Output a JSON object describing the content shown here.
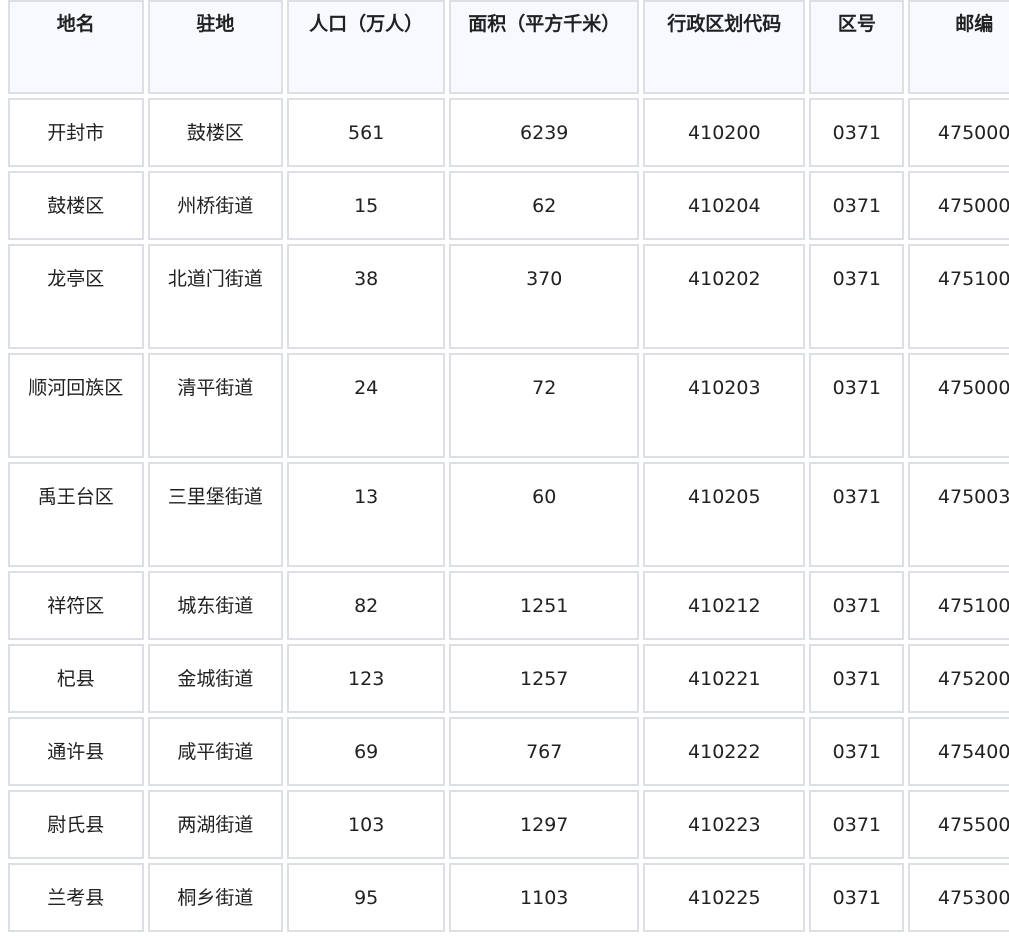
{
  "table": {
    "headers": [
      "地名",
      "驻地",
      "人口（万人）",
      "面积（平方千米）",
      "行政区划代码",
      "区号",
      "邮编"
    ],
    "rows": [
      {
        "name": "开封市",
        "seat": "鼓楼区",
        "population": "561",
        "area": "6239",
        "code": "410200",
        "area_code": "0371",
        "postcode": "475000"
      },
      {
        "name": "鼓楼区",
        "seat": "州桥街道",
        "population": "15",
        "area": "62",
        "code": "410204",
        "area_code": "0371",
        "postcode": "475000"
      },
      {
        "name": "龙亭区",
        "seat": "北道门街道",
        "population": "38",
        "area": "370",
        "code": "410202",
        "area_code": "0371",
        "postcode": "475100"
      },
      {
        "name": "顺河回族区",
        "seat": "清平街道",
        "population": "24",
        "area": "72",
        "code": "410203",
        "area_code": "0371",
        "postcode": "475000"
      },
      {
        "name": "禹王台区",
        "seat": "三里堡街道",
        "population": "13",
        "area": "60",
        "code": "410205",
        "area_code": "0371",
        "postcode": "475003"
      },
      {
        "name": "祥符区",
        "seat": "城东街道",
        "population": "82",
        "area": "1251",
        "code": "410212",
        "area_code": "0371",
        "postcode": "475100"
      },
      {
        "name": "杞县",
        "seat": "金城街道",
        "population": "123",
        "area": "1257",
        "code": "410221",
        "area_code": "0371",
        "postcode": "475200"
      },
      {
        "name": "通许县",
        "seat": "咸平街道",
        "population": "69",
        "area": "767",
        "code": "410222",
        "area_code": "0371",
        "postcode": "475400"
      },
      {
        "name": "尉氏县",
        "seat": "两湖街道",
        "population": "103",
        "area": "1297",
        "code": "410223",
        "area_code": "0371",
        "postcode": "475500"
      },
      {
        "name": "兰考县",
        "seat": "桐乡街道",
        "population": "95",
        "area": "1103",
        "code": "410225",
        "area_code": "0371",
        "postcode": "475300"
      }
    ]
  }
}
